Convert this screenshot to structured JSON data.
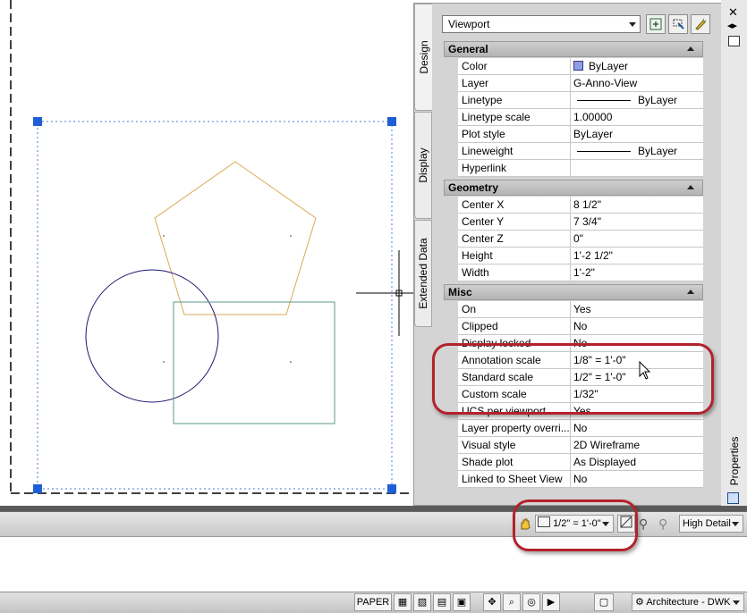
{
  "palette": {
    "object_type": "Viewport",
    "title": "Properties",
    "tabs": [
      "Design",
      "Display",
      "Extended Data"
    ],
    "toolbar_icons": [
      "toggle-pickadd-icon",
      "select-objects-icon",
      "quick-select-icon"
    ],
    "categories": [
      {
        "name": "General",
        "rows": [
          {
            "key": "Color",
            "value": "ByLayer",
            "swatch": "#8e9fe8"
          },
          {
            "key": "Layer",
            "value": "G-Anno-View"
          },
          {
            "key": "Linetype",
            "value": "ByLayer",
            "line": true
          },
          {
            "key": "Linetype scale",
            "value": "1.00000"
          },
          {
            "key": "Plot style",
            "value": "ByLayer"
          },
          {
            "key": "Lineweight",
            "value": "ByLayer",
            "line": true
          },
          {
            "key": "Hyperlink",
            "value": ""
          }
        ]
      },
      {
        "name": "Geometry",
        "rows": [
          {
            "key": "Center X",
            "value": "8 1/2\""
          },
          {
            "key": "Center Y",
            "value": "7 3/4\""
          },
          {
            "key": "Center Z",
            "value": "0\""
          },
          {
            "key": "Height",
            "value": "1'-2 1/2\""
          },
          {
            "key": "Width",
            "value": "1'-2\""
          }
        ]
      },
      {
        "name": "Misc",
        "rows": [
          {
            "key": "On",
            "value": "Yes"
          },
          {
            "key": "Clipped",
            "value": "No"
          },
          {
            "key": "Display locked",
            "value": "No"
          },
          {
            "key": "Annotation scale",
            "value": "1/8\" = 1'-0\""
          },
          {
            "key": "Standard scale",
            "value": "1/2\" = 1'-0\""
          },
          {
            "key": "Custom scale",
            "value": "1/32\""
          },
          {
            "key": "UCS per viewport",
            "value": "Yes"
          },
          {
            "key": "Layer property overri...",
            "value": "No"
          },
          {
            "key": "Visual style",
            "value": "2D Wireframe"
          },
          {
            "key": "Shade plot",
            "value": "As Displayed"
          },
          {
            "key": "Linked to Sheet View",
            "value": "No"
          }
        ]
      }
    ]
  },
  "viewport_status": {
    "scale": "1/2\" = 1'-0\"",
    "detail": "High Detail"
  },
  "status_bar": {
    "paper_label": "PAPER",
    "workspace": "Architecture - DWK"
  },
  "colors": {
    "pentagon": "#d9aa55",
    "circle": "#1a1a6e",
    "rectangle": "#5a9a8a",
    "viewport_border": "#4a7fd4",
    "callout": "#b3222b"
  }
}
